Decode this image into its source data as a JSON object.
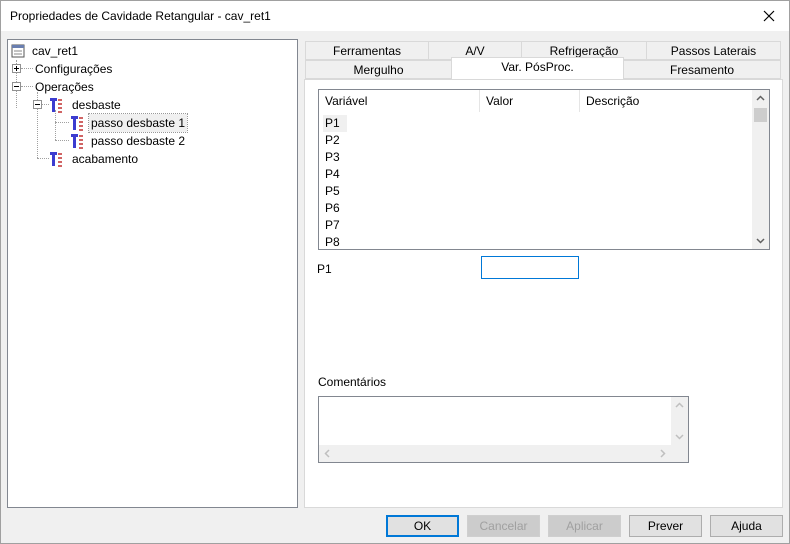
{
  "window": {
    "title": "Propriedades de Cavidade Retangular - cav_ret1"
  },
  "tree": {
    "root": "cav_ret1",
    "configuracoes": "Configurações",
    "operacoes": "Operações",
    "desbaste": "desbaste",
    "passo1": "passo desbaste 1",
    "passo2": "passo desbaste 2",
    "acabamento": "acabamento"
  },
  "tabs": {
    "row1": [
      "Ferramentas",
      "A/V",
      "Refrigeração",
      "Passos Laterais"
    ],
    "row2": [
      "Mergulho",
      "Var. PósProc.",
      "Fresamento"
    ],
    "active": "Var. PósProc."
  },
  "list": {
    "columns": [
      "Variável",
      "Valor",
      "Descrição"
    ],
    "rows": [
      "P1",
      "P2",
      "P3",
      "P4",
      "P5",
      "P6",
      "P7",
      "P8"
    ]
  },
  "form": {
    "selected_var_label": "P1",
    "value": "",
    "comments_label": "Comentários",
    "comments_value": ""
  },
  "buttons": {
    "ok": "OK",
    "cancel": "Cancelar",
    "apply": "Aplicar",
    "preview": "Prever",
    "help": "Ajuda"
  }
}
